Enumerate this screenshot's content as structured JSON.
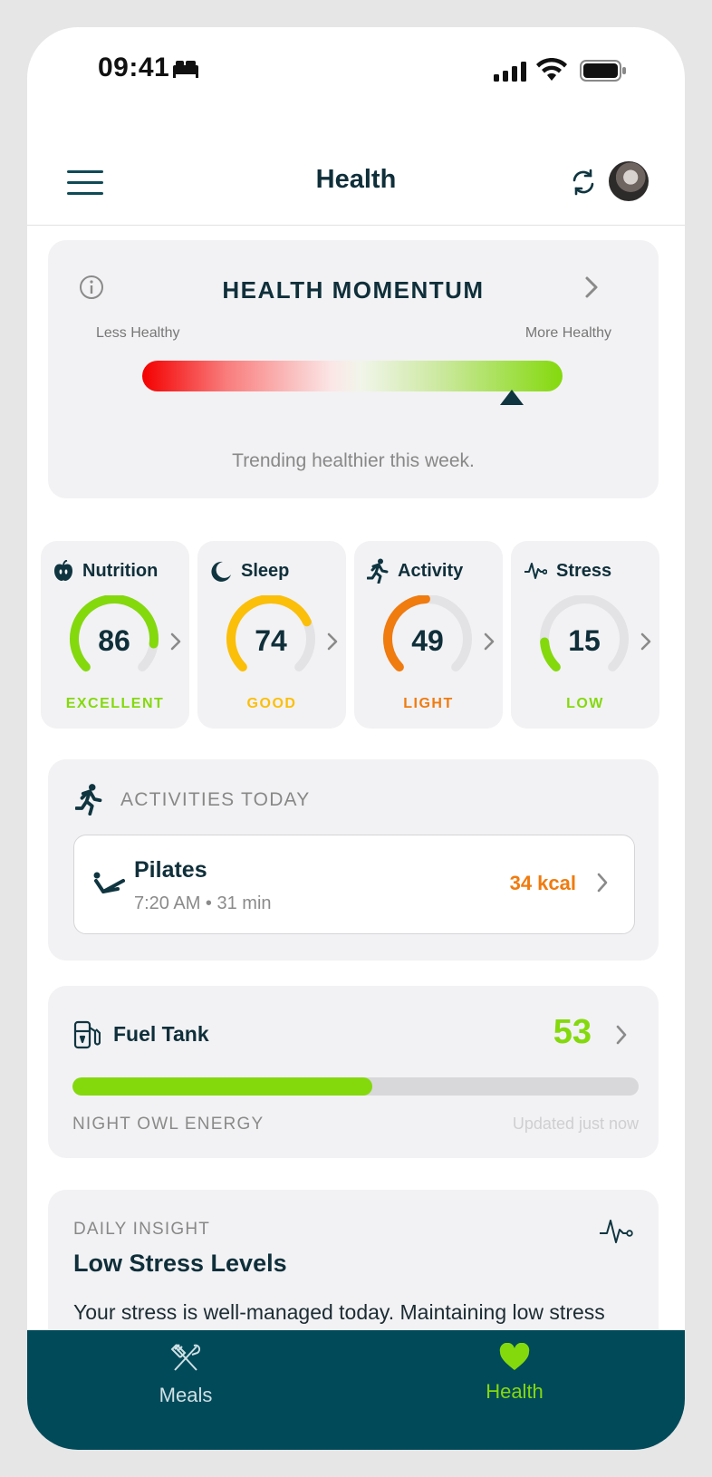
{
  "status_bar": {
    "time": "09:41"
  },
  "header": {
    "title": "Health"
  },
  "momentum": {
    "title": "HEALTH MOMENTUM",
    "left_label": "Less Healthy",
    "right_label": "More Healthy",
    "position": 0.88,
    "trend_text": "Trending healthier this week."
  },
  "metrics": [
    {
      "name": "Nutrition",
      "value": "86",
      "level": 0.86,
      "label": "EXCELLENT",
      "color": "#84d90d",
      "icon": "apple-icon"
    },
    {
      "name": "Sleep",
      "value": "74",
      "level": 0.74,
      "label": "GOOD",
      "color": "#fbbf0a",
      "icon": "moon-icon"
    },
    {
      "name": "Activity",
      "value": "49",
      "level": 0.49,
      "label": "LIGHT",
      "color": "#f07b0f",
      "icon": "runner-icon"
    },
    {
      "name": "Stress",
      "value": "15",
      "level": 0.15,
      "label": "LOW",
      "color": "#84d90d",
      "icon": "pulse-icon"
    }
  ],
  "activities": {
    "heading": "ACTIVITIES TODAY",
    "items": [
      {
        "name": "Pilates",
        "meta": "7:20 AM • 31 min",
        "kcal": "34 kcal"
      }
    ]
  },
  "fuel_tank": {
    "title": "Fuel Tank",
    "value": "53",
    "level": 0.53,
    "subtitle": "NIGHT OWL ENERGY",
    "updated": "Updated just now"
  },
  "insight": {
    "kicker": "DAILY INSIGHT",
    "title": "Low Stress Levels",
    "text": "Your stress is well-managed today. Maintaining low stress supports better sleep, recovery, and overall"
  },
  "tabs": [
    {
      "label": "Meals",
      "icon": "fork-knife-icon",
      "active": false
    },
    {
      "label": "Health",
      "icon": "heart-icon",
      "active": true
    }
  ],
  "colors": {
    "accent_green": "#84d90d",
    "tabbar": "#004a5a",
    "text_dark": "#0f2f3a",
    "orange": "#f07b0f",
    "yellow": "#fbbf0a"
  }
}
